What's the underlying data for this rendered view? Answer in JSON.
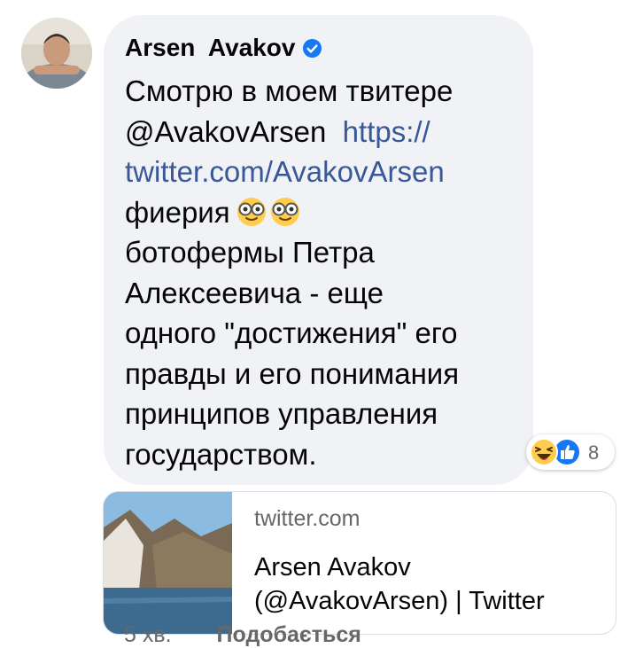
{
  "comment": {
    "author": "Arsen  Avakov",
    "body_lines": [
      "Смотрю в моем твитере",
      "@AvakovArsen",
      "фиерия",
      "ботофермы Петра",
      "Алексеевича - еще",
      "одного \"достижения\" его",
      "правды и его понимания",
      "принципов управления",
      "государством."
    ],
    "link_part1": "https://",
    "link_part2": "twitter.com/AvakovArsen",
    "reaction_count": "8"
  },
  "link_preview": {
    "domain": "twitter.com",
    "title_line1": "Arsen Avakov",
    "title_line2": "(@AvakovArsen) | Twitter"
  },
  "meta": {
    "time": "5 хв.",
    "like_label": "Подобається"
  },
  "icons": {
    "verified": "verified-badge-icon",
    "nerd_emoji": "nerd-face-emoji",
    "haha": "haha-reaction-icon",
    "like": "like-reaction-icon"
  },
  "colors": {
    "bubble": "#f0f2f5",
    "link": "#385898",
    "verified": "#1877f2",
    "meta": "#65676b"
  }
}
